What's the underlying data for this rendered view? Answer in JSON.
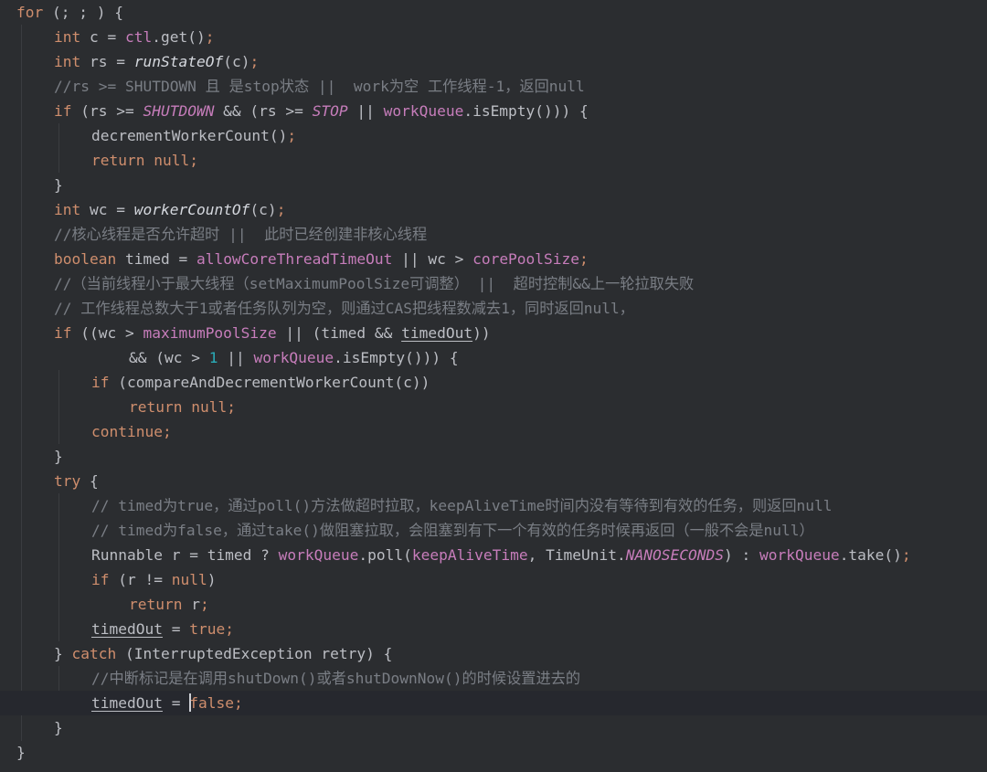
{
  "editor": {
    "language": "java",
    "background": "#2b2d30",
    "current_line_index": 28,
    "caret_line_index": 28,
    "lines": [
      {
        "indent": 0,
        "tokens": [
          {
            "t": "for",
            "c": "kw"
          },
          {
            "t": " (; ; ) {",
            "c": "pln"
          }
        ]
      },
      {
        "indent": 1,
        "tokens": [
          {
            "t": "int",
            "c": "kw"
          },
          {
            "t": " c = ",
            "c": "pln"
          },
          {
            "t": "ctl",
            "c": "fld"
          },
          {
            "t": ".get()",
            "c": "pln"
          },
          {
            "t": ";",
            "c": "kw"
          }
        ]
      },
      {
        "indent": 1,
        "tokens": [
          {
            "t": "int",
            "c": "kw"
          },
          {
            "t": " rs = ",
            "c": "pln"
          },
          {
            "t": "runStateOf",
            "c": "mi"
          },
          {
            "t": "(c)",
            "c": "pln"
          },
          {
            "t": ";",
            "c": "kw"
          }
        ]
      },
      {
        "indent": 1,
        "tokens": [
          {
            "t": "//rs >= SHUTDOWN 且 是stop状态 ||  work为空 工作线程-1，返回null",
            "c": "cmt"
          }
        ]
      },
      {
        "indent": 1,
        "tokens": [
          {
            "t": "if",
            "c": "kw"
          },
          {
            "t": " (rs >= ",
            "c": "pln"
          },
          {
            "t": "SHUTDOWN",
            "c": "fldi"
          },
          {
            "t": " && (rs >= ",
            "c": "pln"
          },
          {
            "t": "STOP",
            "c": "fldi"
          },
          {
            "t": " || ",
            "c": "pln"
          },
          {
            "t": "workQueue",
            "c": "fld"
          },
          {
            "t": ".isEmpty())) {",
            "c": "pln"
          }
        ]
      },
      {
        "indent": 2,
        "tokens": [
          {
            "t": "decrementWorkerCount()",
            "c": "pln"
          },
          {
            "t": ";",
            "c": "kw"
          }
        ]
      },
      {
        "indent": 2,
        "tokens": [
          {
            "t": "return null;",
            "c": "kw"
          }
        ]
      },
      {
        "indent": 1,
        "tokens": [
          {
            "t": "}",
            "c": "pln"
          }
        ]
      },
      {
        "indent": 1,
        "tokens": [
          {
            "t": "int",
            "c": "kw"
          },
          {
            "t": " wc = ",
            "c": "pln"
          },
          {
            "t": "workerCountOf",
            "c": "mi"
          },
          {
            "t": "(c)",
            "c": "pln"
          },
          {
            "t": ";",
            "c": "kw"
          }
        ]
      },
      {
        "indent": 1,
        "tokens": [
          {
            "t": "//核心线程是否允许超时 ||  此时已经创建非核心线程",
            "c": "cmt"
          }
        ]
      },
      {
        "indent": 1,
        "tokens": [
          {
            "t": "boolean",
            "c": "kw"
          },
          {
            "t": " timed = ",
            "c": "pln"
          },
          {
            "t": "allowCoreThreadTimeOut",
            "c": "fld"
          },
          {
            "t": " || wc > ",
            "c": "pln"
          },
          {
            "t": "corePoolSize",
            "c": "fld"
          },
          {
            "t": ";",
            "c": "kw"
          }
        ]
      },
      {
        "indent": 1,
        "tokens": [
          {
            "t": "//（当前线程小于最大线程（setMaximumPoolSize可调整） ||  超时控制&&上一轮拉取失败",
            "c": "cmt"
          }
        ]
      },
      {
        "indent": 1,
        "tokens": [
          {
            "t": "// 工作线程总数大于1或者任务队列为空，则通过CAS把线程数减去1，同时返回null，",
            "c": "cmt"
          }
        ]
      },
      {
        "indent": 1,
        "tokens": [
          {
            "t": "if",
            "c": "kw"
          },
          {
            "t": " ((wc > ",
            "c": "pln"
          },
          {
            "t": "maximumPoolSize",
            "c": "fld"
          },
          {
            "t": " || (timed && ",
            "c": "pln"
          },
          {
            "t": "timedOut",
            "c": "pln ul"
          },
          {
            "t": "))",
            "c": "pln"
          }
        ]
      },
      {
        "indent": 3,
        "tokens": [
          {
            "t": "&& (wc > ",
            "c": "pln"
          },
          {
            "t": "1",
            "c": "num"
          },
          {
            "t": " || ",
            "c": "pln"
          },
          {
            "t": "workQueue",
            "c": "fld"
          },
          {
            "t": ".isEmpty())) {",
            "c": "pln"
          }
        ]
      },
      {
        "indent": 2,
        "tokens": [
          {
            "t": "if",
            "c": "kw"
          },
          {
            "t": " (compareAndDecrementWorkerCount(c))",
            "c": "pln"
          }
        ]
      },
      {
        "indent": 3,
        "tokens": [
          {
            "t": "return null;",
            "c": "kw"
          }
        ]
      },
      {
        "indent": 2,
        "tokens": [
          {
            "t": "continue;",
            "c": "kw"
          }
        ]
      },
      {
        "indent": 1,
        "tokens": [
          {
            "t": "}",
            "c": "pln"
          }
        ]
      },
      {
        "indent": 1,
        "tokens": [
          {
            "t": "try",
            "c": "kw"
          },
          {
            "t": " {",
            "c": "pln"
          }
        ]
      },
      {
        "indent": 2,
        "tokens": [
          {
            "t": "// timed为true，通过poll()方法做超时拉取，keepAliveTime时间内没有等待到有效的任务，则返回null",
            "c": "cmt"
          }
        ]
      },
      {
        "indent": 2,
        "tokens": [
          {
            "t": "// timed为false，通过take()做阻塞拉取，会阻塞到有下一个有效的任务时候再返回（一般不会是null）",
            "c": "cmt"
          }
        ]
      },
      {
        "indent": 2,
        "tokens": [
          {
            "t": "Runnable r = timed ? ",
            "c": "pln"
          },
          {
            "t": "workQueue",
            "c": "fld"
          },
          {
            "t": ".poll(",
            "c": "pln"
          },
          {
            "t": "keepAliveTime",
            "c": "fld"
          },
          {
            "t": ", TimeUnit.",
            "c": "pln"
          },
          {
            "t": "NANOSECONDS",
            "c": "fldi"
          },
          {
            "t": ") : ",
            "c": "pln"
          },
          {
            "t": "workQueue",
            "c": "fld"
          },
          {
            "t": ".take()",
            "c": "pln"
          },
          {
            "t": ";",
            "c": "kw"
          }
        ]
      },
      {
        "indent": 2,
        "tokens": [
          {
            "t": "if",
            "c": "kw"
          },
          {
            "t": " (r != ",
            "c": "pln"
          },
          {
            "t": "null",
            "c": "kw"
          },
          {
            "t": ")",
            "c": "pln"
          }
        ]
      },
      {
        "indent": 3,
        "tokens": [
          {
            "t": "return",
            "c": "kw"
          },
          {
            "t": " r",
            "c": "pln"
          },
          {
            "t": ";",
            "c": "kw"
          }
        ]
      },
      {
        "indent": 2,
        "tokens": [
          {
            "t": "timedOut",
            "c": "pln ul"
          },
          {
            "t": " = ",
            "c": "pln"
          },
          {
            "t": "true;",
            "c": "kw"
          }
        ]
      },
      {
        "indent": 1,
        "tokens": [
          {
            "t": "} ",
            "c": "pln"
          },
          {
            "t": "catch",
            "c": "kw"
          },
          {
            "t": " (InterruptedException retry) {",
            "c": "pln"
          }
        ]
      },
      {
        "indent": 2,
        "tokens": [
          {
            "t": "//中断标记是在调用shutDown()或者shutDownNow()的时候设置进去的",
            "c": "cmt"
          }
        ]
      },
      {
        "indent": 2,
        "tokens": [
          {
            "t": "timedOut",
            "c": "pln ul"
          },
          {
            "t": " = ",
            "c": "pln"
          },
          {
            "t": "fa",
            "c": "kw"
          },
          {
            "t": "lse;",
            "c": "kw"
          }
        ],
        "caret_after_token": 2
      },
      {
        "indent": 1,
        "tokens": [
          {
            "t": "}",
            "c": "pln"
          }
        ]
      },
      {
        "indent": 0,
        "tokens": [
          {
            "t": "}",
            "c": "pln"
          }
        ]
      }
    ]
  }
}
